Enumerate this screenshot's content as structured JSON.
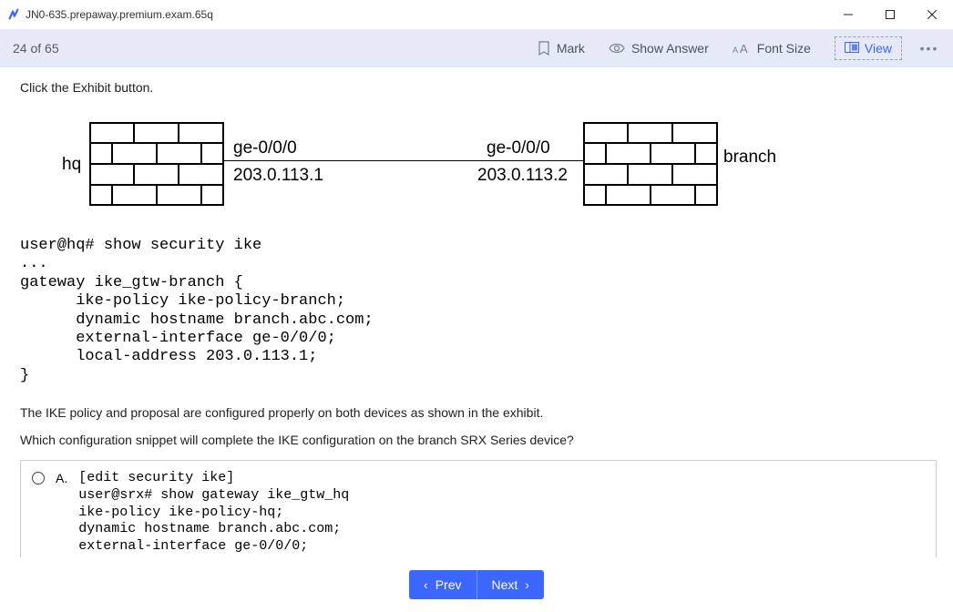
{
  "window": {
    "title": "JN0-635.prepaway.premium.exam.65q"
  },
  "toolbar": {
    "counter": "24 of 65",
    "mark": "Mark",
    "showAnswer": "Show Answer",
    "fontSize": "Font Size",
    "view": "View"
  },
  "question": {
    "instruction": "Click the Exhibit button.",
    "diagram": {
      "hq_label": "hq",
      "branch_label": "branch",
      "left_iface": "ge-0/0/0",
      "left_ip": "203.0.113.1",
      "right_iface": "ge-0/0/0",
      "right_ip": "203.0.113.2"
    },
    "config": "user@hq# show security ike\n...\ngateway ike_gtw-branch {\n      ike-policy ike-policy-branch;\n      dynamic hostname branch.abc.com;\n      external-interface ge-0/0/0;\n      local-address 203.0.113.1;\n}",
    "para1": "The IKE policy and proposal are configured properly on both devices as shown in the exhibit.",
    "para2": "Which configuration snippet will complete the IKE configuration on the branch SRX Series device?",
    "optionA": {
      "letter": "A.",
      "code": "[edit security ike]\nuser@srx# show gateway ike_gtw_hq\nike-policy ike-policy-hq;\ndynamic hostname branch.abc.com;\nexternal-interface ge-0/0/0;"
    }
  },
  "nav": {
    "prev": "Prev",
    "next": "Next"
  }
}
